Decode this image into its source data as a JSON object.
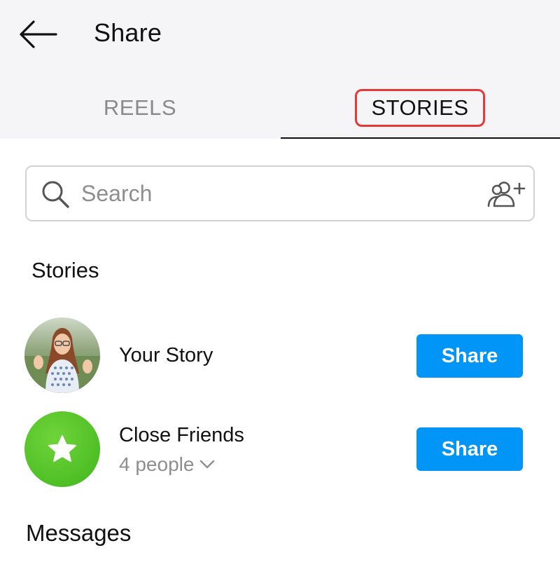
{
  "header": {
    "title": "Share",
    "back_icon": "arrow-left-icon"
  },
  "tabs": [
    {
      "label": "REELS",
      "active": false
    },
    {
      "label": "STORIES",
      "active": true,
      "highlighted": true
    }
  ],
  "search": {
    "placeholder": "Search",
    "value": "",
    "left_icon": "search-icon",
    "right_icon": "add-people-icon"
  },
  "sections": {
    "stories_title": "Stories",
    "messages_title": "Messages"
  },
  "story_rows": [
    {
      "label": "Your Story",
      "subtitle": "",
      "button": "Share",
      "avatar": "profile-photo"
    },
    {
      "label": "Close Friends",
      "subtitle": "4 people",
      "button": "Share",
      "avatar": "star-icon"
    }
  ],
  "colors": {
    "accent": "#0095f6",
    "highlight_border": "#e53935",
    "close_friends_green": "#4fbf26",
    "muted_text": "#8e8e8e"
  }
}
